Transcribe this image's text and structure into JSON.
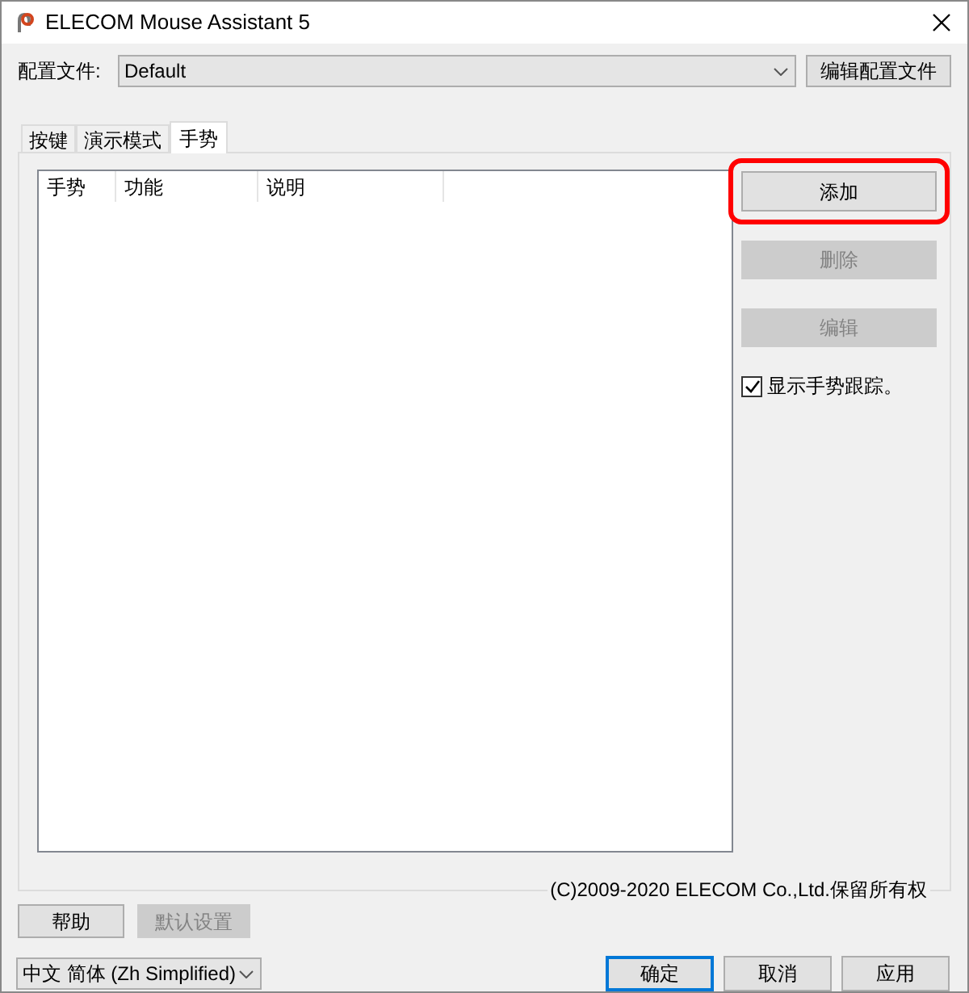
{
  "window": {
    "title": "ELECOM Mouse Assistant 5"
  },
  "profile": {
    "label": "配置文件:",
    "value": "Default",
    "edit_button": "编辑配置文件"
  },
  "tabs": [
    {
      "label": "按键",
      "selected": false
    },
    {
      "label": "演示模式",
      "selected": false
    },
    {
      "label": "手势",
      "selected": true
    }
  ],
  "table": {
    "columns": [
      "手势",
      "功能",
      "说明"
    ]
  },
  "side_buttons": [
    {
      "label": "添加",
      "disabled": false,
      "highlighted": true
    },
    {
      "label": "删除",
      "disabled": true,
      "highlighted": false
    },
    {
      "label": "编辑",
      "disabled": true,
      "highlighted": false
    }
  ],
  "show_trail": {
    "label": "显示手势跟踪。",
    "checked": true
  },
  "copyright": "(C)2009-2020 ELECOM Co.,Ltd.保留所有权",
  "bottom_buttons": [
    {
      "label": "帮助",
      "disabled": false
    },
    {
      "label": "默认设置",
      "disabled": true
    }
  ],
  "language": {
    "value": "中文 简体 (Zh Simplified)"
  },
  "dialog_buttons": [
    {
      "label": "确定",
      "default": true
    },
    {
      "label": "取消",
      "default": false
    },
    {
      "label": "应用",
      "default": false
    }
  ]
}
